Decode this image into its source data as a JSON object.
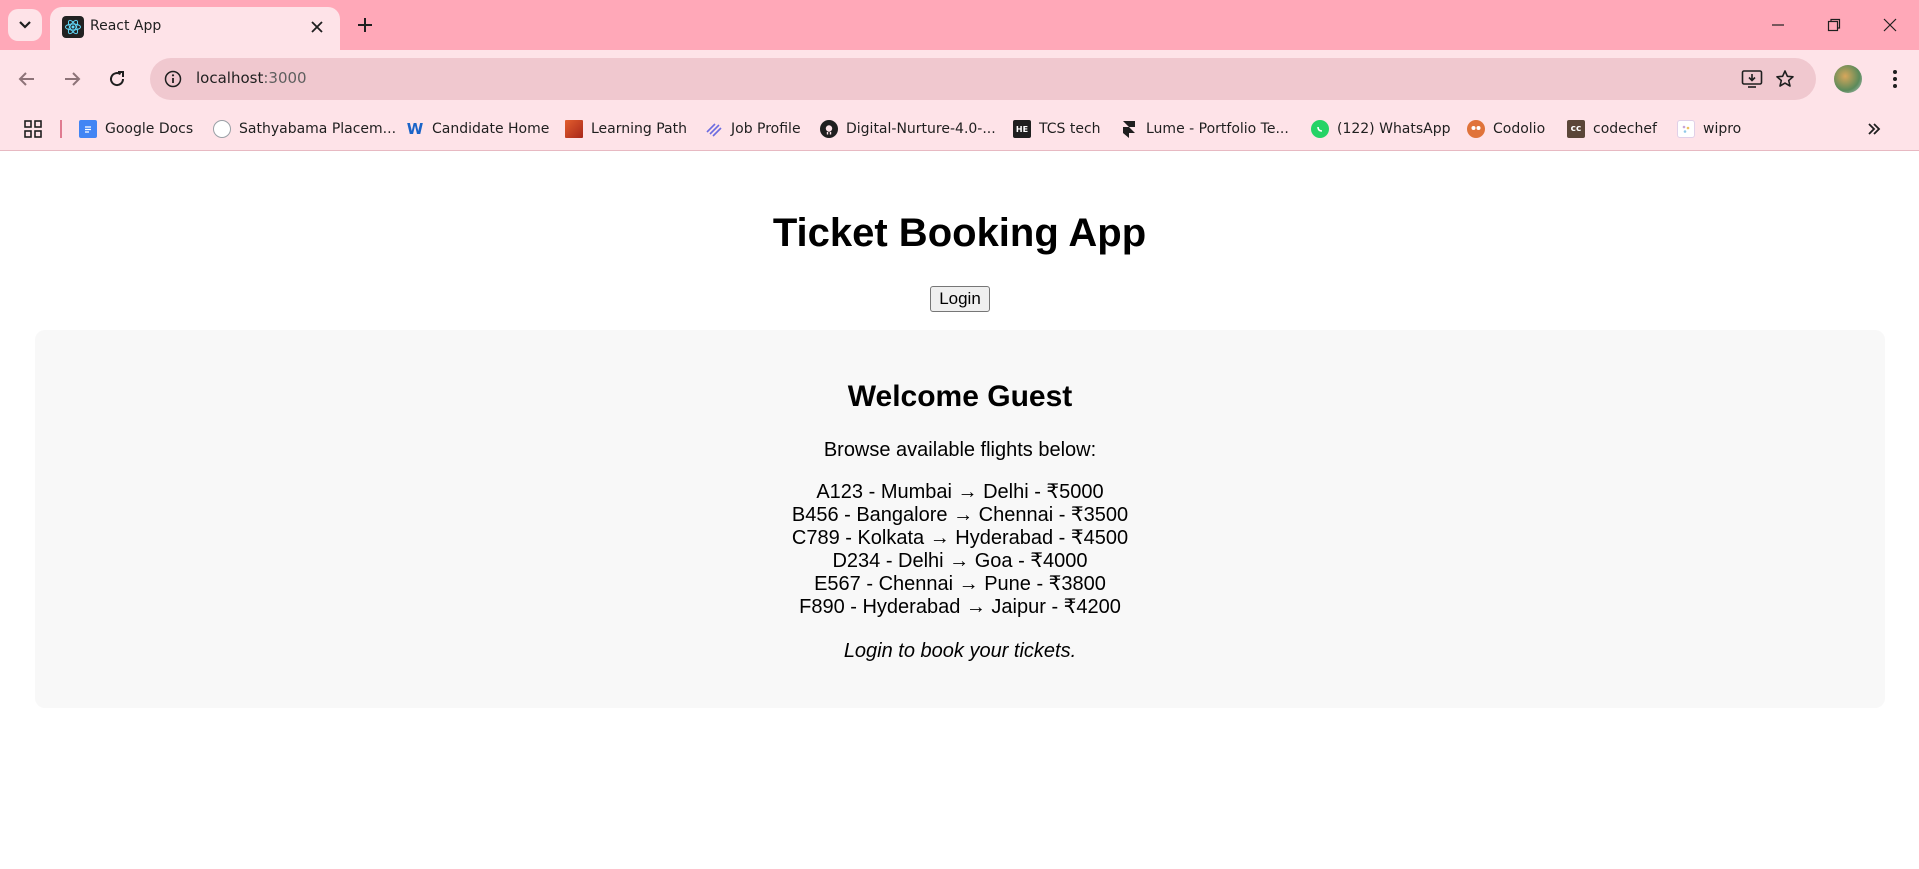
{
  "browser": {
    "tab_title": "React App",
    "url_host": "localhost",
    "url_port": ":3000",
    "bookmarks": [
      {
        "label": "Google Docs",
        "icon": "google-docs-icon",
        "color": "#4285f4"
      },
      {
        "label": "Sathyabama Placem...",
        "icon": "sathyabama-icon",
        "color": "#9aa0a6"
      },
      {
        "label": "Candidate Home",
        "icon": "workday-icon",
        "color": "#f5a623"
      },
      {
        "label": "Learning Path",
        "icon": "learning-path-icon",
        "color": "#c0391b"
      },
      {
        "label": "Job Profile",
        "icon": "job-profile-icon",
        "color": "#6b6be0"
      },
      {
        "label": "Digital-Nurture-4.0-...",
        "icon": "github-icon",
        "color": "#1f1f1f"
      },
      {
        "label": "TCS tech",
        "icon": "hackerearth-icon",
        "color": "#1f1f1f"
      },
      {
        "label": "Lume - Portfolio Te...",
        "icon": "framer-icon",
        "color": "#1f1f1f"
      },
      {
        "label": "(122) WhatsApp",
        "icon": "whatsapp-icon",
        "color": "#25d366"
      },
      {
        "label": "Codolio",
        "icon": "codolio-icon",
        "color": "#e0733a"
      },
      {
        "label": "codechef",
        "icon": "codechef-icon",
        "color": "#5b4638"
      },
      {
        "label": "wipro",
        "icon": "wipro-icon",
        "color": "#c9a5d6"
      }
    ]
  },
  "app": {
    "title": "Ticket Booking App",
    "login_button": "Login",
    "welcome": "Welcome Guest",
    "browse_text": "Browse available flights below:",
    "flights": [
      "A123 - Mumbai → Delhi - ₹5000",
      "B456 - Bangalore → Chennai - ₹3500",
      "C789 - Kolkata → Hyderabad - ₹4500",
      "D234 - Delhi → Goa - ₹4000",
      "E567 - Chennai → Pune - ₹3800",
      "F890 - Hyderabad → Jaipur - ₹4200"
    ],
    "login_note": "Login to book your tickets."
  }
}
